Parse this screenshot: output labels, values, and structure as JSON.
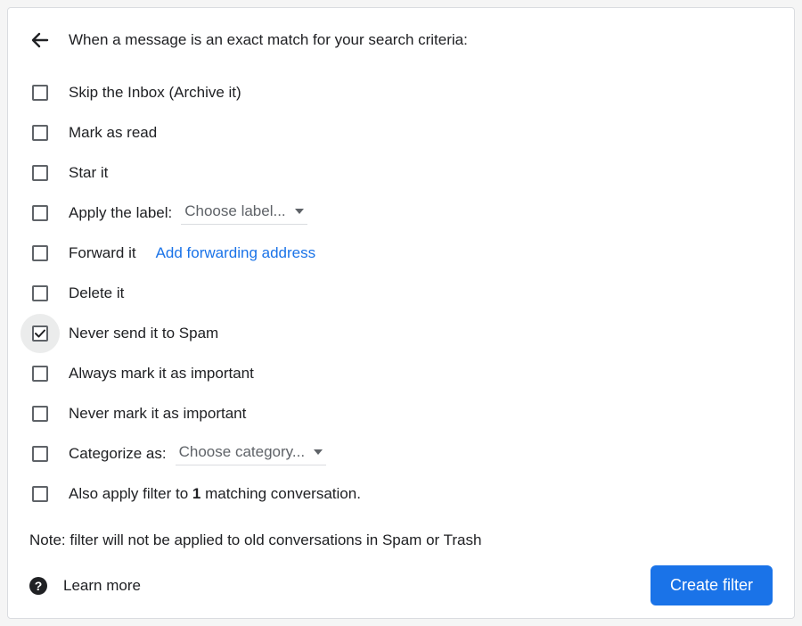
{
  "header": {
    "title": "When a message is an exact match for your search criteria:"
  },
  "options": {
    "skip_inbox": "Skip the Inbox (Archive it)",
    "mark_read": "Mark as read",
    "star_it": "Star it",
    "apply_label": "Apply the label:",
    "apply_label_select": "Choose label...",
    "forward_it": "Forward it",
    "forward_link": "Add forwarding address",
    "delete_it": "Delete it",
    "never_spam": "Never send it to Spam",
    "always_important": "Always mark it as important",
    "never_important": "Never mark it as important",
    "categorize_as": "Categorize as:",
    "categorize_select": "Choose category...",
    "also_apply_pre": "Also apply filter to ",
    "also_apply_count": "1",
    "also_apply_post": " matching conversation."
  },
  "note": "Note: filter will not be applied to old conversations in Spam or Trash",
  "footer": {
    "learn_more": "Learn more",
    "create_filter": "Create filter"
  }
}
